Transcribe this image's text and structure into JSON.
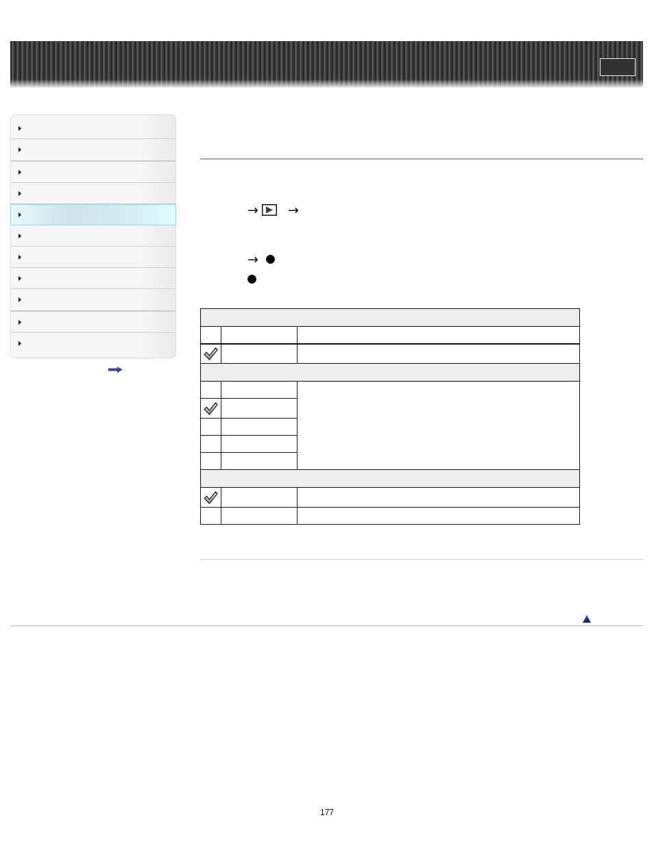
{
  "sidebar": {
    "groups": [
      {
        "items": [
          {
            "selected": false
          },
          {
            "selected": false
          }
        ]
      },
      {
        "items": [
          {
            "selected": false
          },
          {
            "selected": false
          },
          {
            "selected": true
          },
          {
            "selected": false
          },
          {
            "selected": false
          },
          {
            "selected": false
          },
          {
            "selected": false
          }
        ]
      },
      {
        "items": [
          {
            "selected": false
          },
          {
            "selected": false
          }
        ]
      }
    ]
  },
  "steps": [
    {
      "parts": [
        {
          "kind": "arrow",
          "text": "→"
        },
        {
          "kind": "play-button"
        },
        {
          "kind": "arrow",
          "text": "→"
        }
      ]
    },
    {
      "parts": [
        {
          "kind": "arrow",
          "text": "→"
        },
        {
          "kind": "bullet"
        }
      ]
    },
    {
      "parts": [
        {
          "kind": "bullet"
        }
      ]
    }
  ],
  "table": {
    "sections": [
      {
        "kind": "split",
        "rows": [
          {
            "kind": "heading",
            "checked": false
          },
          {
            "kind": "option",
            "checked": true
          }
        ]
      },
      {
        "kind": "merged",
        "rows": [
          {
            "kind": "option",
            "checked": false
          },
          {
            "kind": "option",
            "checked": true
          },
          {
            "kind": "option",
            "checked": false
          },
          {
            "kind": "option",
            "checked": false
          },
          {
            "kind": "option",
            "checked": false
          }
        ]
      },
      {
        "kind": "split",
        "rows": [
          {
            "kind": "option",
            "checked": true
          },
          {
            "kind": "option",
            "checked": false
          }
        ]
      }
    ]
  },
  "page_number": "177"
}
